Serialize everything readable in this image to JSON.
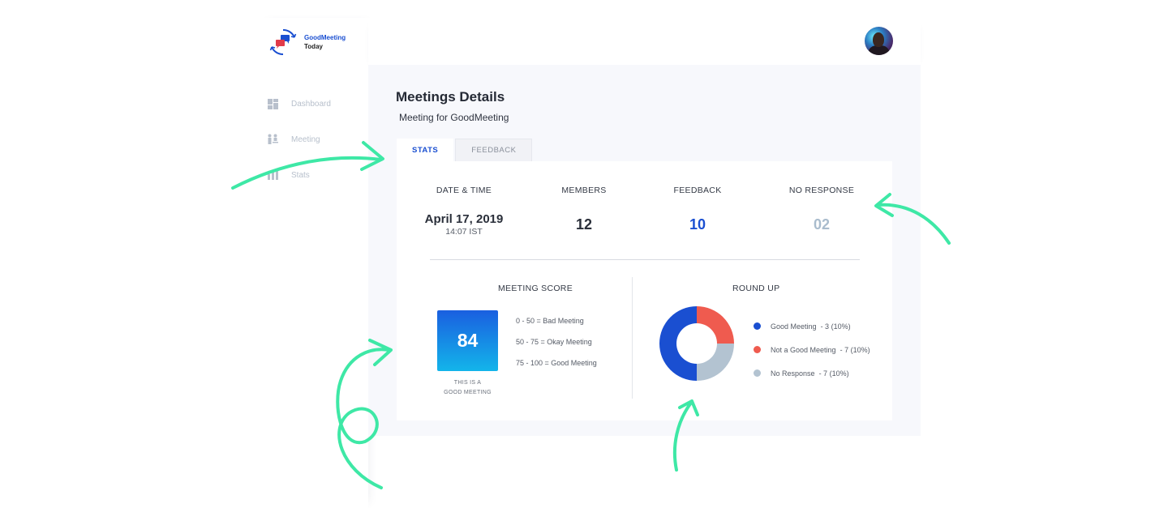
{
  "app": {
    "logo_line1": "GoodMeeting",
    "logo_line2": "Today"
  },
  "sidebar": {
    "items": [
      {
        "label": "Dashboard",
        "icon": "dashboard-icon"
      },
      {
        "label": "Meeting",
        "icon": "meeting-icon"
      },
      {
        "label": "Stats",
        "icon": "stats-icon"
      }
    ]
  },
  "header": {
    "avatar": "user-avatar"
  },
  "page": {
    "title": "Meetings Details",
    "subtitle": "Meeting for GoodMeeting"
  },
  "tabs": [
    {
      "label": "STATS",
      "active": true
    },
    {
      "label": "FEEDBACK",
      "active": false
    }
  ],
  "stats": {
    "date_time": {
      "label": "DATE & TIME",
      "date": "April 17, 2019",
      "time": "14:07 IST"
    },
    "members": {
      "label": "MEMBERS",
      "value": "12"
    },
    "feedback": {
      "label": "FEEDBACK",
      "value": "10"
    },
    "no_response": {
      "label": "NO RESPONSE",
      "value": "02"
    }
  },
  "meeting_score": {
    "title": "MEETING SCORE",
    "score": "84",
    "caption_line1": "THIS IS A",
    "caption_line2": "GOOD MEETING",
    "scale": [
      "0 - 50 = Bad Meeting",
      "50 - 75 = Okay Meeting",
      "75 - 100 = Good Meeting"
    ]
  },
  "round_up": {
    "title": "ROUND UP",
    "legend": [
      {
        "label": "Good Meeting",
        "detail": "- 3 (10%)",
        "color": "#1a4fd1"
      },
      {
        "label": "Not a Good Meeting",
        "detail": "- 7 (10%)",
        "color": "#ef5b4f"
      },
      {
        "label": "No Response",
        "detail": "- 7 (10%)",
        "color": "#b3c3d1"
      }
    ],
    "slices": [
      {
        "name": "Good Meeting",
        "fraction": 0.5,
        "color": "#1a4fd1"
      },
      {
        "name": "Not a Good Meeting",
        "fraction": 0.25,
        "color": "#ef5b4f"
      },
      {
        "name": "No Response",
        "fraction": 0.25,
        "color": "#b3c3d1"
      }
    ]
  },
  "colors": {
    "accent": "#1a4fd1",
    "muted_value": "#a9bccd",
    "arrow": "#3ee8a6"
  }
}
